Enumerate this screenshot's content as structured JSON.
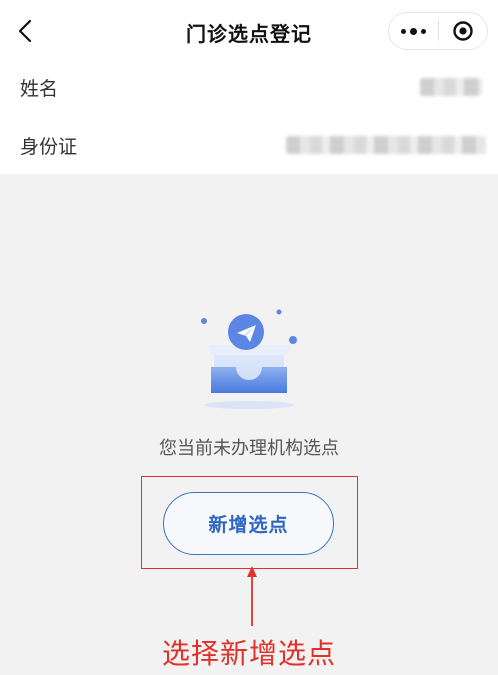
{
  "header": {
    "title": "门诊选点登记"
  },
  "info": {
    "name_label": "姓名",
    "id_label": "身份证"
  },
  "empty_state": {
    "message": "您当前未办理机构选点",
    "add_button_label": "新增选点"
  },
  "annotation": {
    "text": "选择新增选点"
  },
  "colors": {
    "accent_blue": "#3b73c9",
    "annotation_red": "#e0322b",
    "background": "#f2f2f2"
  },
  "icons": {
    "back": "chevron-left-icon",
    "more": "more-dots-icon",
    "close": "target-close-icon",
    "illustration": "empty-inbox-paper-plane-icon"
  }
}
